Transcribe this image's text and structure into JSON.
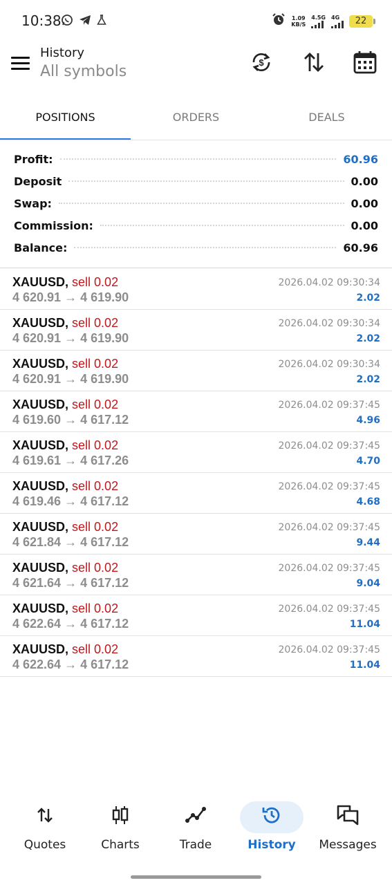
{
  "status_bar": {
    "time": "10:38",
    "net_speed_value": "1.09",
    "net_speed_unit": "KB/S",
    "signal1_label": "4.5G",
    "signal2_label": "4G",
    "battery_level": "22",
    "icons": [
      "whatsapp-icon",
      "telegram-icon",
      "flask-icon",
      "alarm-icon"
    ]
  },
  "app_bar": {
    "title": "History",
    "subtitle": "All symbols",
    "actions": [
      "currency-sync-icon",
      "sort-icon",
      "calendar-icon"
    ]
  },
  "tabs": [
    {
      "label": "POSITIONS",
      "active": true
    },
    {
      "label": "ORDERS",
      "active": false
    },
    {
      "label": "DEALS",
      "active": false
    }
  ],
  "summary": [
    {
      "label": "Profit:",
      "value": "60.96",
      "highlight": true
    },
    {
      "label": "Deposit",
      "value": "0.00",
      "highlight": false
    },
    {
      "label": "Swap:",
      "value": "0.00",
      "highlight": false
    },
    {
      "label": "Commission:",
      "value": "0.00",
      "highlight": false
    },
    {
      "label": "Balance:",
      "value": "60.96",
      "highlight": false
    }
  ],
  "deals": [
    {
      "symbol": "XAUUSD,",
      "side": "sell 0.02",
      "open_price": "4 620.91",
      "arrow": "→",
      "close_price": "4 619.90",
      "time": "2026.04.02 09:30:34",
      "profit": "2.02"
    },
    {
      "symbol": "XAUUSD,",
      "side": "sell 0.02",
      "open_price": "4 620.91",
      "arrow": "→",
      "close_price": "4 619.90",
      "time": "2026.04.02 09:30:34",
      "profit": "2.02"
    },
    {
      "symbol": "XAUUSD,",
      "side": "sell 0.02",
      "open_price": "4 620.91",
      "arrow": "→",
      "close_price": "4 619.90",
      "time": "2026.04.02 09:30:34",
      "profit": "2.02"
    },
    {
      "symbol": "XAUUSD,",
      "side": "sell 0.02",
      "open_price": "4 619.60",
      "arrow": "→",
      "close_price": "4 617.12",
      "time": "2026.04.02 09:37:45",
      "profit": "4.96"
    },
    {
      "symbol": "XAUUSD,",
      "side": "sell 0.02",
      "open_price": "4 619.61",
      "arrow": "→",
      "close_price": "4 617.26",
      "time": "2026.04.02 09:37:45",
      "profit": "4.70"
    },
    {
      "symbol": "XAUUSD,",
      "side": "sell 0.02",
      "open_price": "4 619.46",
      "arrow": "→",
      "close_price": "4 617.12",
      "time": "2026.04.02 09:37:45",
      "profit": "4.68"
    },
    {
      "symbol": "XAUUSD,",
      "side": "sell 0.02",
      "open_price": "4 621.84",
      "arrow": "→",
      "close_price": "4 617.12",
      "time": "2026.04.02 09:37:45",
      "profit": "9.44"
    },
    {
      "symbol": "XAUUSD,",
      "side": "sell 0.02",
      "open_price": "4 621.64",
      "arrow": "→",
      "close_price": "4 617.12",
      "time": "2026.04.02 09:37:45",
      "profit": "9.04"
    },
    {
      "symbol": "XAUUSD,",
      "side": "sell 0.02",
      "open_price": "4 622.64",
      "arrow": "→",
      "close_price": "4 617.12",
      "time": "2026.04.02 09:37:45",
      "profit": "11.04"
    },
    {
      "symbol": "XAUUSD,",
      "side": "sell 0.02",
      "open_price": "4 622.64",
      "arrow": "→",
      "close_price": "4 617.12",
      "time": "2026.04.02 09:37:45",
      "profit": "11.04"
    }
  ],
  "bottom_nav": [
    {
      "label": "Quotes",
      "icon": "quotes-arrows-icon",
      "active": false
    },
    {
      "label": "Charts",
      "icon": "candlestick-icon",
      "active": false
    },
    {
      "label": "Trade",
      "icon": "trend-line-icon",
      "active": false
    },
    {
      "label": "History",
      "icon": "history-clock-icon",
      "active": true
    },
    {
      "label": "Messages",
      "icon": "chat-bubbles-icon",
      "active": false
    }
  ],
  "colors": {
    "accent": "#1f6fc6",
    "tab_indicator": "#2a7ae2",
    "sell": "#c0171c",
    "muted": "#8d8d8d"
  }
}
